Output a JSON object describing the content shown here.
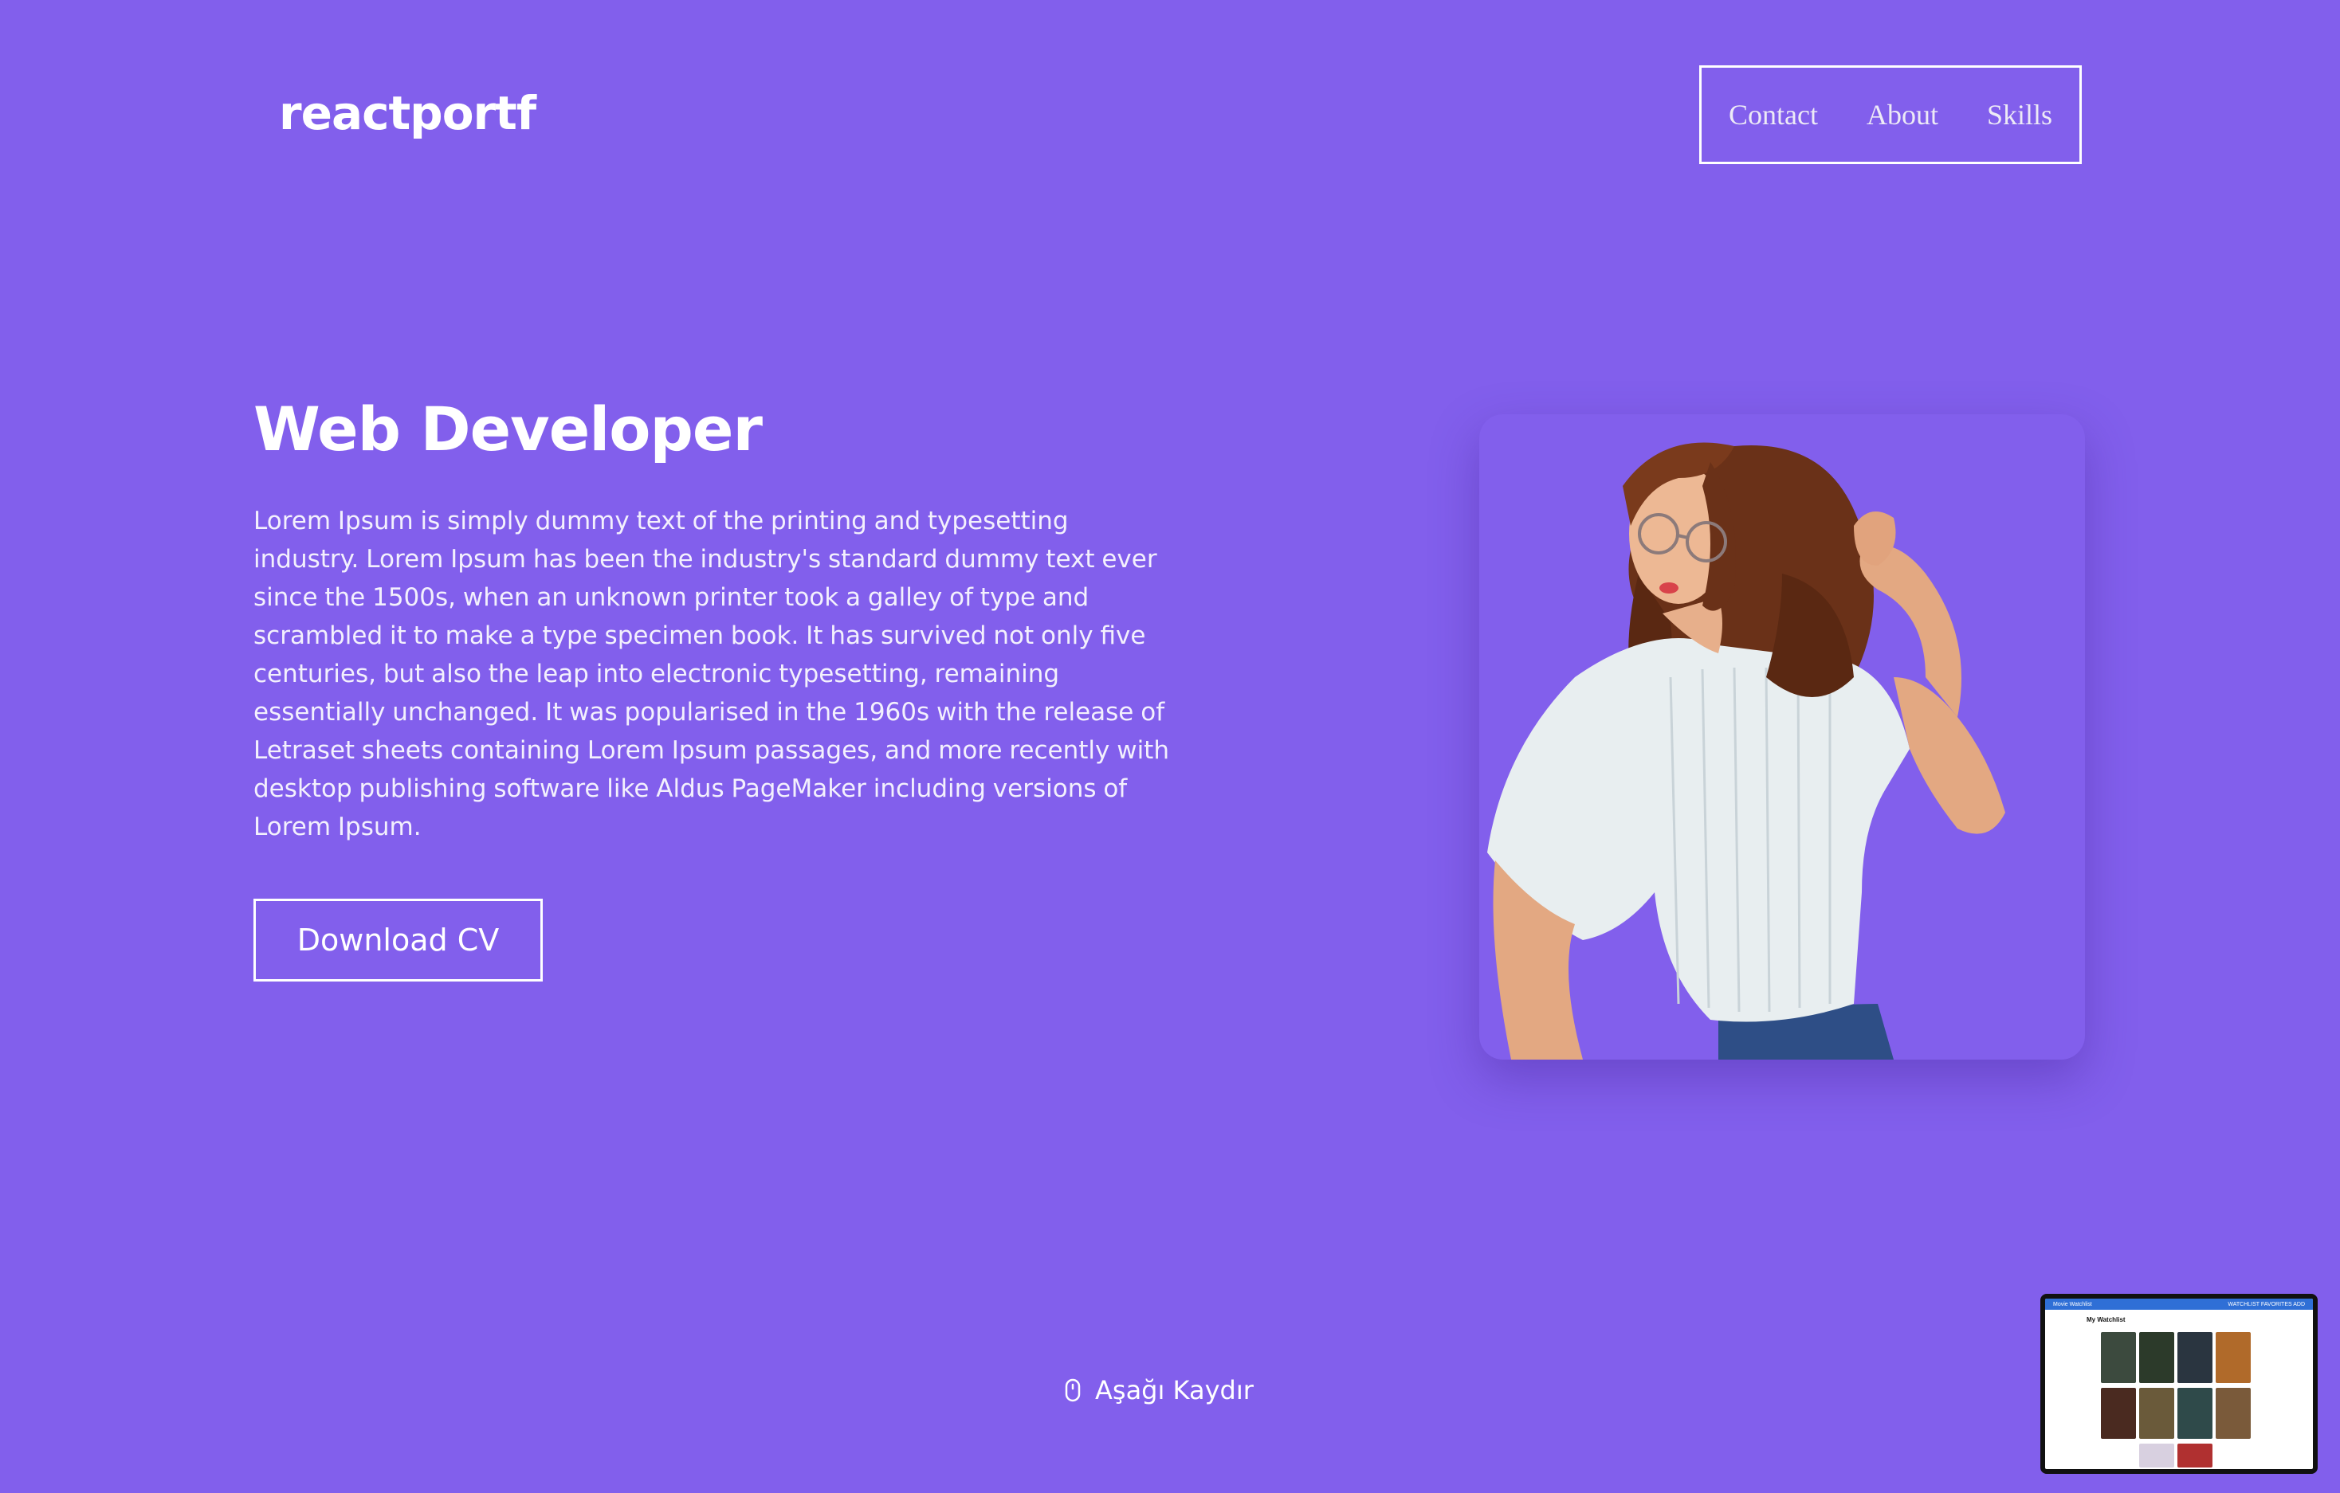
{
  "header": {
    "logo": "reactportf",
    "nav": [
      "Contact",
      "About",
      "Skills"
    ]
  },
  "hero": {
    "title": "Web Developer",
    "description": "Lorem Ipsum is simply dummy text of the printing and typesetting industry. Lorem Ipsum has been the industry's standard dummy text ever since the 1500s, when an unknown printer took a galley of type and scrambled it to make a type specimen book. It has survived not only five centuries, but also the leap into electronic typesetting, remaining essentially unchanged. It was popularised in the 1960s with the release of Letraset sheets containing Lorem Ipsum passages, and more recently with desktop publishing software like Aldus PageMaker including versions of Lorem Ipsum.",
    "cta_label": "Download CV",
    "photo_icon": "portrait-photo"
  },
  "scroll": {
    "label": "Aşağı Kaydır",
    "icon": "mouse-icon"
  },
  "thumbnail": {
    "title": "Movie Watchlist",
    "nav_text": "WATCHLIST  FAVORITES  ADD",
    "heading": "My Watchlist"
  },
  "colors": {
    "background": "#825FEC",
    "text": "#FFFFFF",
    "thumbnail_bar": "#2F6FD6"
  }
}
